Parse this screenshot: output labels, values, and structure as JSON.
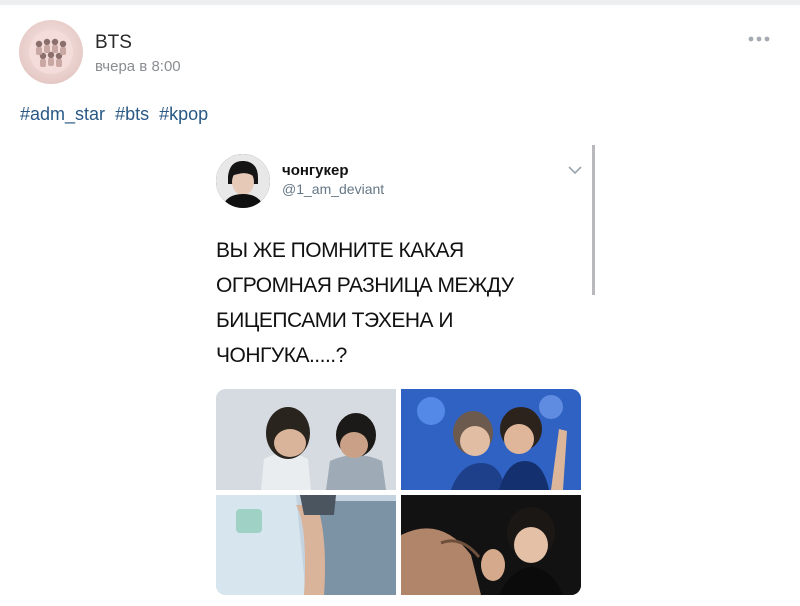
{
  "post": {
    "author": "BTS",
    "date": "вчера в 8:00",
    "menu_icon": "more-dots-icon",
    "hashtags": [
      "#adm_star",
      "#bts",
      "#kpop"
    ]
  },
  "tweet": {
    "name": "чонгукер",
    "handle": "@1_am_deviant",
    "text_lines": [
      "ВЫ ЖЕ ПОМНИТЕ КАКАЯ",
      "ОГРОМНАЯ РАЗНИЦА МЕЖДУ",
      "БИЦЕПСАМИ ТЭХЕНА И",
      "ЧОНГУКА.....?"
    ],
    "chevron_icon": "chevron-down-icon"
  },
  "colors": {
    "link": "#2a5885",
    "page_bg": "#edeef0",
    "secondary_text": "#8a8d91"
  }
}
